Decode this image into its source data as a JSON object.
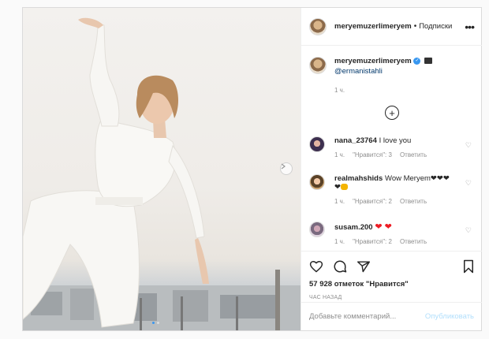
{
  "post": {
    "author": "meryemuzerlimeryem",
    "separator": "•",
    "follow_label": "Подписки",
    "more_label": "•••",
    "caption": {
      "username": "meryemuzerlimeryem",
      "verified_icon": "✓",
      "mention": "@ermanistahli",
      "time": "1 ч."
    },
    "load_more_label": "+",
    "comments": [
      {
        "username": "nana_23764",
        "text": "I love you",
        "time": "1 ч.",
        "likes": "\"Нравится\": 3",
        "reply": "Ответить"
      },
      {
        "username": "realmahshids",
        "text": "Wow Meryem❤❤❤",
        "text2": "❤",
        "time": "1 ч.",
        "likes": "\"Нравится\": 2",
        "reply": "Ответить"
      },
      {
        "username": "susam.200",
        "text": "❤ ❤",
        "time": "1 ч.",
        "likes": "\"Нравится\": 2",
        "reply": "Ответить"
      }
    ],
    "likes_text": "57 928 отметок \"Нравится\"",
    "posted_ago": "ЧАС НАЗАД",
    "comment_input": {
      "placeholder": "Добавьте комментарий...",
      "value": ""
    },
    "publish_label": "Опубликовать",
    "heart_glyph": "♡",
    "carousel": {
      "slides": 2,
      "active": 1
    }
  },
  "colors": {
    "accent": "#3897f0",
    "publish_disabled": "#b2dffc",
    "muted": "#8e8e8e"
  }
}
